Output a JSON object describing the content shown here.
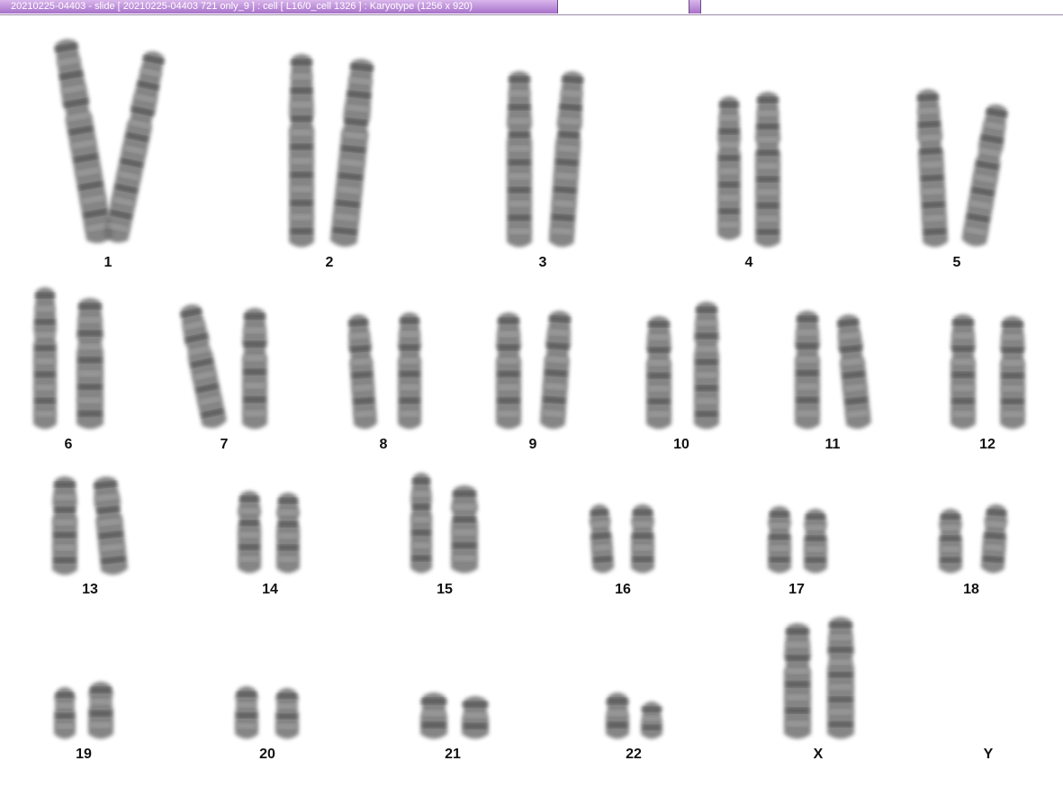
{
  "window": {
    "title": "20210225-04403 - slide [ 20210225-04403 721 only_9 ] : cell [ L16/0_cell 1326 ] : Karyotype  (1256 x 920)"
  },
  "karyotype": {
    "pairs": [
      {
        "label": "1",
        "count": 2
      },
      {
        "label": "2",
        "count": 2
      },
      {
        "label": "3",
        "count": 2
      },
      {
        "label": "4",
        "count": 2
      },
      {
        "label": "5",
        "count": 2
      },
      {
        "label": "6",
        "count": 2
      },
      {
        "label": "7",
        "count": 2
      },
      {
        "label": "8",
        "count": 2
      },
      {
        "label": "9",
        "count": 2
      },
      {
        "label": "10",
        "count": 2
      },
      {
        "label": "11",
        "count": 2
      },
      {
        "label": "12",
        "count": 2
      },
      {
        "label": "13",
        "count": 2
      },
      {
        "label": "14",
        "count": 2
      },
      {
        "label": "15",
        "count": 2
      },
      {
        "label": "16",
        "count": 2
      },
      {
        "label": "17",
        "count": 2
      },
      {
        "label": "18",
        "count": 2
      },
      {
        "label": "19",
        "count": 2
      },
      {
        "label": "20",
        "count": 2
      },
      {
        "label": "21",
        "count": 2
      },
      {
        "label": "22",
        "count": 2
      },
      {
        "label": "X",
        "count": 2
      },
      {
        "label": "Y",
        "count": 0
      }
    ]
  },
  "colors": {
    "titlebar_top": "#d9b6ec",
    "titlebar_bottom": "#a772c9",
    "chromosome": "#6f6f6f"
  }
}
